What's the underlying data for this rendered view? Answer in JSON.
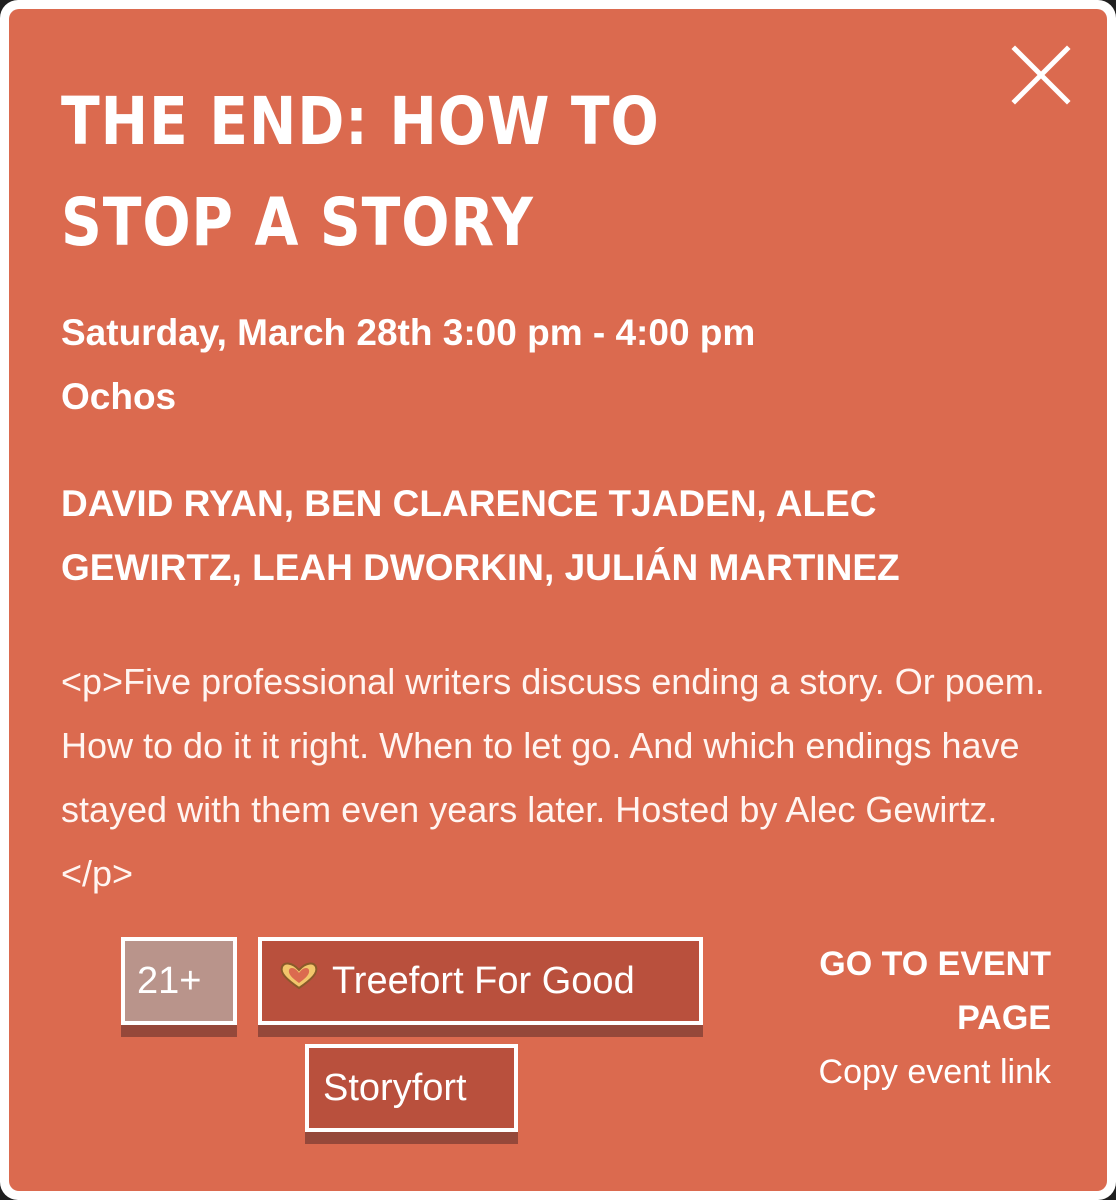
{
  "event": {
    "title": "THE END: HOW TO STOP A STORY",
    "when": "Saturday, March 28th 3:00 pm - 4:00 pm",
    "venue": "Ochos",
    "performers": "DAVID RYAN, BEN CLARENCE TJADEN, ALEC GEWIRTZ, LEAH DWORKIN, JULIÁN MARTINEZ",
    "description": "<p>Five professional writers discuss ending a story. Or poem. How to do it it right. When to let go. And which endings have stayed with them even years later. Hosted by Alec Gewirtz. </p>"
  },
  "tags": {
    "age": "21+",
    "good": "Treefort For Good",
    "story": "Storyfort"
  },
  "actions": {
    "go_to_event": "GO TO EVENT PAGE",
    "copy_link": "Copy event link"
  },
  "icons": {
    "close": "close-icon",
    "heart": "heart-hands-icon"
  },
  "colors": {
    "background": "#db6a4f",
    "tag": "#b9503d",
    "age_tag": "#b9948b",
    "tag_shadow": "#95483a",
    "heart": "#f2c66b"
  }
}
